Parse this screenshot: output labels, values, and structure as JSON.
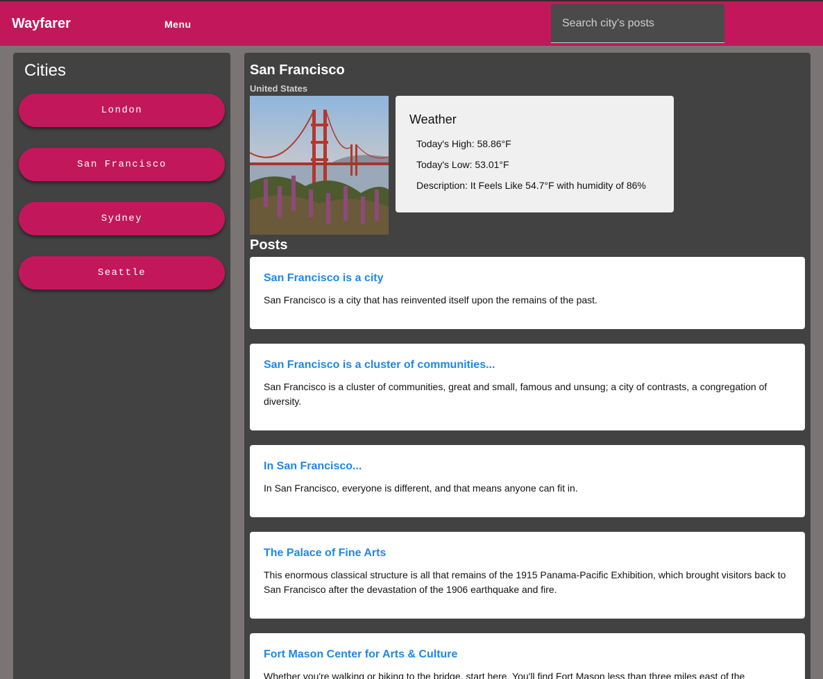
{
  "app": {
    "brand": "Wayfarer",
    "menu_label": "Menu"
  },
  "search": {
    "placeholder": "Search city's posts",
    "value": ""
  },
  "sidebar": {
    "title": "Cities",
    "cities": [
      "London",
      "San Francisco",
      "Sydney",
      "Seattle"
    ]
  },
  "city": {
    "name": "San Francisco",
    "country": "United States",
    "photo_icon": "golden-gate-bridge-photo"
  },
  "weather": {
    "title": "Weather",
    "high": "Today's High: 58.86°F",
    "low": "Today's Low: 53.01°F",
    "description": "Description: It Feels Like 54.7°F with humidity of 86%"
  },
  "posts_title": "Posts",
  "posts": [
    {
      "title": "San Francisco is a city",
      "body": "San Francisco is a city that has reinvented itself upon the remains of the past."
    },
    {
      "title": "San Francisco is a cluster of communities...",
      "body": "San Francisco is a cluster of communities, great and small, famous and unsung; a city of contrasts, a congregation of diversity."
    },
    {
      "title": "In San Francisco...",
      "body": "In San Francisco, everyone is different, and that means anyone can fit in."
    },
    {
      "title": "The Palace of Fine Arts",
      "body": "This enormous classical structure is all that remains of the 1915 Panama-Pacific Exhibition, which brought visitors back to San Francisco after the devastation of the 1906 earthquake and fire."
    },
    {
      "title": "Fort Mason Center for Arts & Culture",
      "body": "Whether you're walking or biking to the bridge, start here. You'll find Fort Mason less than three miles east of the"
    }
  ],
  "colors": {
    "primary": "#c2185b",
    "panel": "#424242",
    "link": "#1e88e5",
    "page_bg": "#7a7474"
  }
}
